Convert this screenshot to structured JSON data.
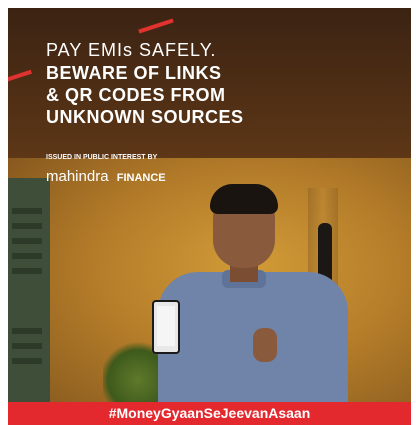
{
  "headline": {
    "line1": "PAY EMIs SAFELY.",
    "line2": "BEWARE OF LINKS",
    "line3": "& QR CODES FROM",
    "line4": "UNKNOWN SOURCES"
  },
  "issued_note": "ISSUED IN PUBLIC INTEREST BY",
  "brand": {
    "name": "mahindra",
    "suffix": "FINANCE"
  },
  "footer_hashtag": "#MoneyGyaanSeJeevanAsaan",
  "colors": {
    "accent_red": "#e3282e",
    "text": "#ffffff"
  }
}
